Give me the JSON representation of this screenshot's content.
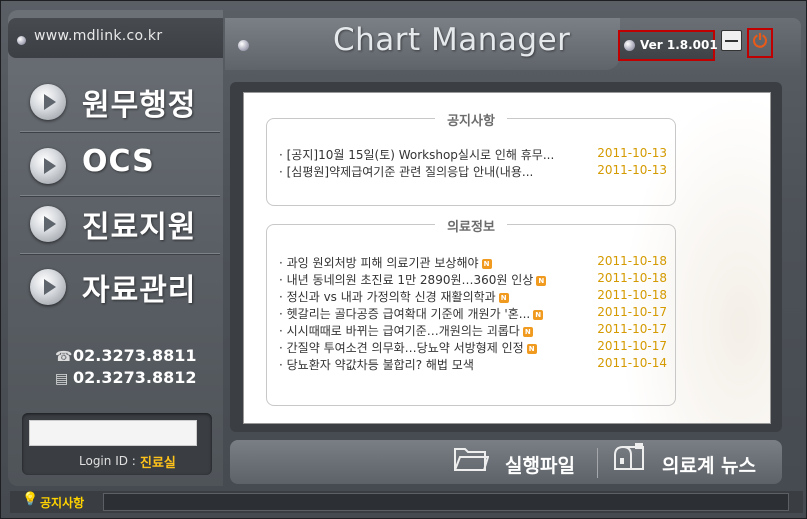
{
  "app": {
    "url": "www.mdlink.co.kr",
    "title": "Chart Manager",
    "version": "Ver 1.8.001"
  },
  "sidebar": {
    "menu": [
      {
        "label": "원무행정"
      },
      {
        "label": "OCS"
      },
      {
        "label": "진료지원"
      },
      {
        "label": "자료관리"
      }
    ],
    "phones": [
      {
        "icon": "telephone-icon",
        "number": "02.3273.8811"
      },
      {
        "icon": "fax-icon",
        "number": "02.3273.8812"
      }
    ],
    "login": {
      "label": "Login ID :",
      "value": "진료실",
      "field_value": ""
    }
  },
  "notice_box": {
    "title": "공지사항",
    "items": [
      {
        "text": "· [공지]10월 15일(토) Workshop실시로 인해 휴무...",
        "date": "2011-10-13",
        "new": false
      },
      {
        "text": "· [심평원]약제급여기준 관련 질의응답 안내(내용...",
        "date": "2011-10-13",
        "new": false
      }
    ]
  },
  "medical_box": {
    "title": "의료정보",
    "items": [
      {
        "text": "· 과잉 원외처방 피해 의료기관 보상해야",
        "date": "2011-10-18",
        "new": true
      },
      {
        "text": "· 내년 동네의원 초진료 1만 2890원…360원 인상",
        "date": "2011-10-18",
        "new": true
      },
      {
        "text": "· 정신과 vs 내과 가정의학 신경 재활의학과",
        "date": "2011-10-18",
        "new": true
      },
      {
        "text": "· 헷갈리는 골다공증 급여확대 기준에 개원가 '혼...",
        "date": "2011-10-17",
        "new": true
      },
      {
        "text": "· 시시때때로 바뀌는 급여기준…개원의는 괴롭다",
        "date": "2011-10-17",
        "new": true
      },
      {
        "text": "· 간질약 투여소견 의무화…당뇨약 서방형제 인정",
        "date": "2011-10-17",
        "new": true
      },
      {
        "text": "· 당뇨환자 약값차등 불합리? 해법 모색",
        "date": "2011-10-14",
        "new": false
      }
    ],
    "new_badge": "N"
  },
  "bottom": {
    "run_file": "실행파일",
    "news": "의료계 뉴스"
  },
  "status": {
    "label": "공지사항",
    "text": ""
  },
  "colors": {
    "accent_date": "#d49a00",
    "login_value": "#ffc21a",
    "highlight_box": "#c00000",
    "notice": "#ffd300"
  }
}
